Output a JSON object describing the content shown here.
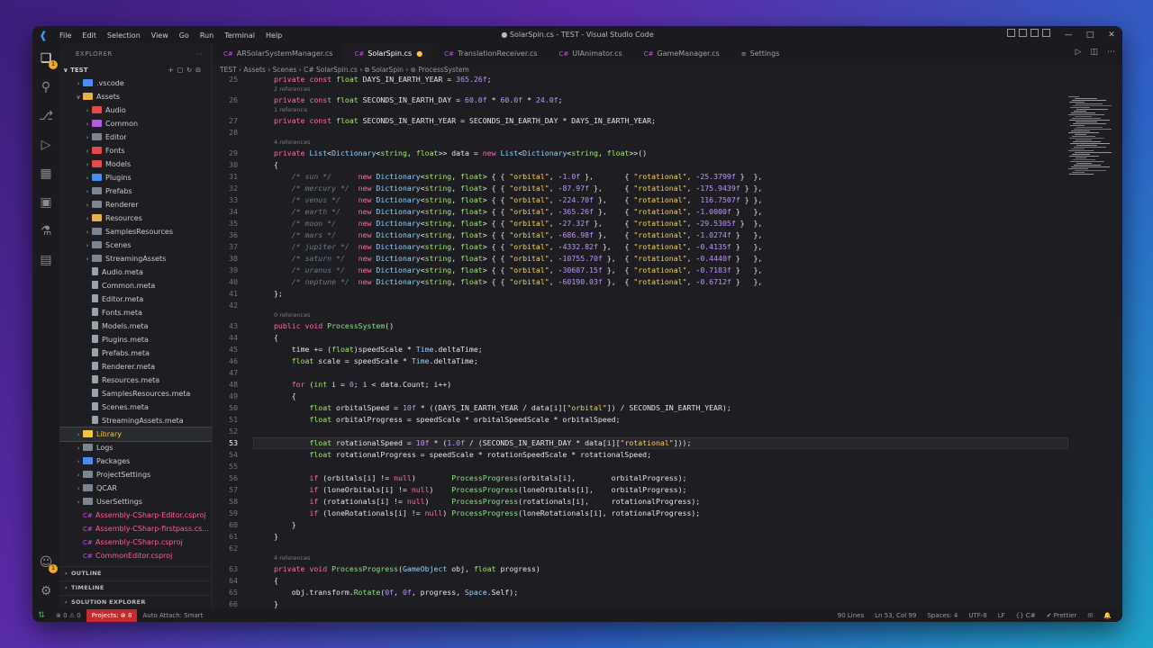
{
  "titlebar": {
    "menu": [
      "File",
      "Edit",
      "Selection",
      "View",
      "Go",
      "Run",
      "Terminal",
      "Help"
    ],
    "title": "● SolarSpin.cs - TEST - Visual Studio Code"
  },
  "sidebar": {
    "header": "EXPLORER",
    "root": "TEST",
    "items": [
      {
        "label": ".vscode",
        "depth": 1,
        "kind": "folder",
        "color": "#4b8bf5"
      },
      {
        "label": "Assets",
        "depth": 1,
        "kind": "folder-open",
        "color": "#e8b04a"
      },
      {
        "label": "Audio",
        "depth": 2,
        "kind": "folder",
        "color": "#e04b4b"
      },
      {
        "label": "Common",
        "depth": 2,
        "kind": "folder",
        "color": "#b85adf"
      },
      {
        "label": "Editor",
        "depth": 2,
        "kind": "folder",
        "color": "#7d8590"
      },
      {
        "label": "Fonts",
        "depth": 2,
        "kind": "folder",
        "color": "#e04b4b"
      },
      {
        "label": "Models",
        "depth": 2,
        "kind": "folder",
        "color": "#e04b4b"
      },
      {
        "label": "Plugins",
        "depth": 2,
        "kind": "folder",
        "color": "#4b8bf5"
      },
      {
        "label": "Prefabs",
        "depth": 2,
        "kind": "folder",
        "color": "#7d8590"
      },
      {
        "label": "Renderer",
        "depth": 2,
        "kind": "folder",
        "color": "#7d8590"
      },
      {
        "label": "Resources",
        "depth": 2,
        "kind": "folder",
        "color": "#e8b04a"
      },
      {
        "label": "SamplesResources",
        "depth": 2,
        "kind": "folder",
        "color": "#7d8590"
      },
      {
        "label": "Scenes",
        "depth": 2,
        "kind": "folder",
        "color": "#7d8590"
      },
      {
        "label": "StreamingAssets",
        "depth": 2,
        "kind": "folder",
        "color": "#7d8590"
      },
      {
        "label": "Audio.meta",
        "depth": 2,
        "kind": "file",
        "color": "#9aa3ad"
      },
      {
        "label": "Common.meta",
        "depth": 2,
        "kind": "file",
        "color": "#9aa3ad"
      },
      {
        "label": "Editor.meta",
        "depth": 2,
        "kind": "file",
        "color": "#9aa3ad"
      },
      {
        "label": "Fonts.meta",
        "depth": 2,
        "kind": "file",
        "color": "#9aa3ad"
      },
      {
        "label": "Models.meta",
        "depth": 2,
        "kind": "file",
        "color": "#9aa3ad"
      },
      {
        "label": "Plugins.meta",
        "depth": 2,
        "kind": "file",
        "color": "#9aa3ad"
      },
      {
        "label": "Prefabs.meta",
        "depth": 2,
        "kind": "file",
        "color": "#9aa3ad"
      },
      {
        "label": "Renderer.meta",
        "depth": 2,
        "kind": "file",
        "color": "#9aa3ad"
      },
      {
        "label": "Resources.meta",
        "depth": 2,
        "kind": "file",
        "color": "#9aa3ad"
      },
      {
        "label": "SamplesResources.meta",
        "depth": 2,
        "kind": "file",
        "color": "#9aa3ad"
      },
      {
        "label": "Scenes.meta",
        "depth": 2,
        "kind": "file",
        "color": "#9aa3ad"
      },
      {
        "label": "StreamingAssets.meta",
        "depth": 2,
        "kind": "file",
        "color": "#9aa3ad"
      },
      {
        "label": "Library",
        "depth": 1,
        "kind": "folder",
        "color": "#f5c542",
        "selected": true
      },
      {
        "label": "Logs",
        "depth": 1,
        "kind": "folder",
        "color": "#7d8590"
      },
      {
        "label": "Packages",
        "depth": 1,
        "kind": "folder",
        "color": "#4b8bf5"
      },
      {
        "label": "ProjectSettings",
        "depth": 1,
        "kind": "folder",
        "color": "#7d8590"
      },
      {
        "label": "QCAR",
        "depth": 1,
        "kind": "folder",
        "color": "#7d8590"
      },
      {
        "label": "UserSettings",
        "depth": 1,
        "kind": "folder",
        "color": "#7d8590"
      },
      {
        "label": "Assembly-CSharp-Editor.csproj",
        "depth": 1,
        "kind": "csproj",
        "color": "#c74cff"
      },
      {
        "label": "Assembly-CSharp-firstpass.cs...",
        "depth": 1,
        "kind": "csproj",
        "color": "#c74cff"
      },
      {
        "label": "Assembly-CSharp.csproj",
        "depth": 1,
        "kind": "csproj",
        "color": "#c74cff"
      },
      {
        "label": "CommonEditor.csproj",
        "depth": 1,
        "kind": "csproj",
        "color": "#c74cff"
      }
    ],
    "sections": [
      "OUTLINE",
      "TIMELINE",
      "SOLUTION EXPLORER"
    ]
  },
  "tabs": [
    {
      "label": "ARSolarSystemManager.cs",
      "active": false
    },
    {
      "label": "SolarSpin.cs",
      "active": true,
      "modified": true
    },
    {
      "label": "TranslationReceiver.cs",
      "active": false
    },
    {
      "label": "UIAnimator.cs",
      "active": false
    },
    {
      "label": "GameManager.cs",
      "active": false
    },
    {
      "label": "Settings",
      "active": false
    }
  ],
  "breadcrumb": "TEST › Assets › Scenes › C# SolarSpin.cs › ⧉ SolarSpin › ⊛ ProcessSystem",
  "code_lines": [
    {
      "ln": "25",
      "text": "private const float DAYS_IN_EARTH_YEAR = 365.26f;"
    },
    {
      "lens": "2 references"
    },
    {
      "ln": "26",
      "text": "private const float SECONDS_IN_EARTH_DAY = 60.0f * 60.0f * 24.0f;"
    },
    {
      "lens": "1 reference"
    },
    {
      "ln": "27",
      "text": "private const float SECONDS_IN_EARTH_YEAR = SECONDS_IN_EARTH_DAY * DAYS_IN_EARTH_YEAR;"
    },
    {
      "ln": "28",
      "text": ""
    },
    {
      "lens": "4 references"
    },
    {
      "ln": "29",
      "text": "private List<Dictionary<string, float>> data = new List<Dictionary<string, float>>()"
    },
    {
      "ln": "30",
      "text": "{"
    },
    {
      "ln": "31",
      "text": "    /* sun */      new Dictionary<string, float> { { \"orbital\", -1.0f },       { \"rotational\", -25.3799f }  },"
    },
    {
      "ln": "32",
      "text": "    /* mercury */  new Dictionary<string, float> { { \"orbital\", -87.97f },     { \"rotational\", -175.9439f } },"
    },
    {
      "ln": "33",
      "text": "    /* venus */    new Dictionary<string, float> { { \"orbital\", -224.70f },    { \"rotational\",  116.7507f } },"
    },
    {
      "ln": "34",
      "text": "    /* earth */    new Dictionary<string, float> { { \"orbital\", -365.26f },    { \"rotational\", -1.0000f }   },"
    },
    {
      "ln": "35",
      "text": "    /* moon */     new Dictionary<string, float> { { \"orbital\", -27.32f },     { \"rotational\", -29.5305f }  },"
    },
    {
      "ln": "36",
      "text": "    /* mars */     new Dictionary<string, float> { { \"orbital\", -686.98f },    { \"rotational\", -1.0274f }   },"
    },
    {
      "ln": "37",
      "text": "    /* jupiter */  new Dictionary<string, float> { { \"orbital\", -4332.82f },   { \"rotational\", -0.4135f }   },"
    },
    {
      "ln": "38",
      "text": "    /* saturn */   new Dictionary<string, float> { { \"orbital\", -10755.70f },  { \"rotational\", -0.4440f }   },"
    },
    {
      "ln": "39",
      "text": "    /* uranus */   new Dictionary<string, float> { { \"orbital\", -30687.15f },  { \"rotational\", -0.7183f }   },"
    },
    {
      "ln": "40",
      "text": "    /* neptune */  new Dictionary<string, float> { { \"orbital\", -60190.03f },  { \"rotational\", -0.6712f }   },"
    },
    {
      "ln": "41",
      "text": "};"
    },
    {
      "ln": "42",
      "text": ""
    },
    {
      "lens": "0 references"
    },
    {
      "ln": "43",
      "text": "public void ProcessSystem()"
    },
    {
      "ln": "44",
      "text": "{"
    },
    {
      "ln": "45",
      "text": "    time += (float)speedScale * Time.deltaTime;"
    },
    {
      "ln": "46",
      "text": "    float scale = speedScale * Time.deltaTime;"
    },
    {
      "ln": "47",
      "text": ""
    },
    {
      "ln": "48",
      "text": "    for (int i = 0; i < data.Count; i++)"
    },
    {
      "ln": "49",
      "text": "    {"
    },
    {
      "ln": "50",
      "text": "        float orbitalSpeed = 10f * ((DAYS_IN_EARTH_YEAR / data[i][\"orbital\"]) / SECONDS_IN_EARTH_YEAR);"
    },
    {
      "ln": "51",
      "text": "        float orbitalProgress = speedScale * orbitalSpeedScale * orbitalSpeed;"
    },
    {
      "ln": "52",
      "text": ""
    },
    {
      "ln": "53",
      "text": "        float rotationalSpeed = 10f * (1.0f / (SECONDS_IN_EARTH_DAY * data[i][\"rotational\"]));",
      "current": true
    },
    {
      "ln": "54",
      "text": "        float rotationalProgress = speedScale * rotationSpeedScale * rotationalSpeed;"
    },
    {
      "ln": "55",
      "text": ""
    },
    {
      "ln": "56",
      "text": "        if (orbitals[i] != null)        ProcessProgress(orbitals[i],        orbitalProgress);"
    },
    {
      "ln": "57",
      "text": "        if (loneOrbitals[i] != null)    ProcessProgress(loneOrbitals[i],    orbitalProgress);"
    },
    {
      "ln": "58",
      "text": "        if (rotationals[i] != null)     ProcessProgress(rotationals[i],     rotationalProgress);"
    },
    {
      "ln": "59",
      "text": "        if (loneRotationals[i] != null) ProcessProgress(loneRotationals[i], rotationalProgress);"
    },
    {
      "ln": "60",
      "text": "    }"
    },
    {
      "ln": "61",
      "text": "}"
    },
    {
      "ln": "62",
      "text": ""
    },
    {
      "lens": "4 references"
    },
    {
      "ln": "63",
      "text": "private void ProcessProgress(GameObject obj, float progress)"
    },
    {
      "ln": "64",
      "text": "{"
    },
    {
      "ln": "65",
      "text": "    obj.transform.Rotate(0f, 0f, progress, Space.Self);"
    },
    {
      "ln": "66",
      "text": "}"
    }
  ],
  "status": {
    "errors": "⊗ 0 ⚠ 0",
    "projects": "Projects: ⊗ 8",
    "attach": "Auto Attach: Smart",
    "lines": "90 Lines",
    "position": "Ln 53, Col 99",
    "spaces": "Spaces: 4",
    "encoding": "UTF-8",
    "eol": "LF",
    "language": "{} C#",
    "prettier": "✔ Prettier"
  },
  "colors": {
    "keyword": "#ff6bae",
    "type": "#a1e96a",
    "string": "#f5d15c",
    "number": "#bd93f9",
    "comment": "#6a7a8c"
  }
}
